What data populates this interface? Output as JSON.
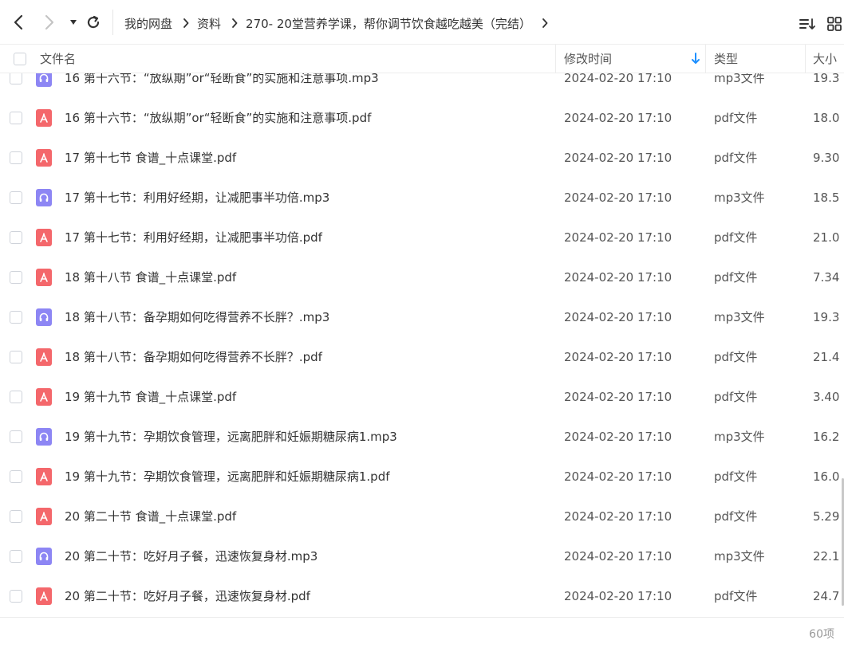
{
  "breadcrumb": {
    "items": [
      {
        "label": "我的网盘"
      },
      {
        "label": "资料"
      },
      {
        "label": "270- 20堂营养学课，帮你调节饮食越吃越美（完结）"
      }
    ]
  },
  "toolbar": {
    "back_icon": "chevron-left-icon",
    "forward_icon": "chevron-right-icon",
    "dropdown_icon": "caret-down-icon",
    "refresh_icon": "refresh-icon",
    "sort_icon": "sort-list-icon",
    "view_icon": "grid-view-icon"
  },
  "table": {
    "columns": {
      "name": "文件名",
      "modified": "修改时间",
      "type": "类型",
      "size": "大小"
    },
    "sort_indicator": "arrow-down-icon",
    "rows": [
      {
        "kind": "mp3",
        "name": "16 第十六节：“放纵期”or“轻断食”的实施和注意事项.mp3",
        "modified": "2024-02-20 17:10",
        "type": "mp3文件",
        "size": "19.3"
      },
      {
        "kind": "pdf",
        "name": "16 第十六节：“放纵期”or“轻断食”的实施和注意事项.pdf",
        "modified": "2024-02-20 17:10",
        "type": "pdf文件",
        "size": "18.0"
      },
      {
        "kind": "pdf",
        "name": "17 第十七节 食谱_十点课堂.pdf",
        "modified": "2024-02-20 17:10",
        "type": "pdf文件",
        "size": "9.30"
      },
      {
        "kind": "mp3",
        "name": "17 第十七节：利用好经期，让减肥事半功倍.mp3",
        "modified": "2024-02-20 17:10",
        "type": "mp3文件",
        "size": "18.5"
      },
      {
        "kind": "pdf",
        "name": "17 第十七节：利用好经期，让减肥事半功倍.pdf",
        "modified": "2024-02-20 17:10",
        "type": "pdf文件",
        "size": "21.0"
      },
      {
        "kind": "pdf",
        "name": "18 第十八节 食谱_十点课堂.pdf",
        "modified": "2024-02-20 17:10",
        "type": "pdf文件",
        "size": "7.34"
      },
      {
        "kind": "mp3",
        "name": "18 第十八节：备孕期如何吃得营养不长胖？.mp3",
        "modified": "2024-02-20 17:10",
        "type": "mp3文件",
        "size": "19.3"
      },
      {
        "kind": "pdf",
        "name": "18 第十八节：备孕期如何吃得营养不长胖？.pdf",
        "modified": "2024-02-20 17:10",
        "type": "pdf文件",
        "size": "21.4"
      },
      {
        "kind": "pdf",
        "name": "19 第十九节 食谱_十点课堂.pdf",
        "modified": "2024-02-20 17:10",
        "type": "pdf文件",
        "size": "3.40"
      },
      {
        "kind": "mp3",
        "name": "19 第十九节：孕期饮食管理，远离肥胖和妊娠期糖尿病1.mp3",
        "modified": "2024-02-20 17:10",
        "type": "mp3文件",
        "size": "16.2"
      },
      {
        "kind": "pdf",
        "name": "19 第十九节：孕期饮食管理，远离肥胖和妊娠期糖尿病1.pdf",
        "modified": "2024-02-20 17:10",
        "type": "pdf文件",
        "size": "16.0"
      },
      {
        "kind": "pdf",
        "name": "20 第二十节 食谱_十点课堂.pdf",
        "modified": "2024-02-20 17:10",
        "type": "pdf文件",
        "size": "5.29"
      },
      {
        "kind": "mp3",
        "name": "20 第二十节：吃好月子餐，迅速恢复身材.mp3",
        "modified": "2024-02-20 17:10",
        "type": "mp3文件",
        "size": "22.1"
      },
      {
        "kind": "pdf",
        "name": "20 第二十节：吃好月子餐，迅速恢复身材.pdf",
        "modified": "2024-02-20 17:10",
        "type": "pdf文件",
        "size": "24.7"
      }
    ]
  },
  "footer": {
    "count": "60项"
  },
  "colors": {
    "pdf_icon": "#f4676b",
    "mp3_icon": "#8d86f4",
    "sort_accent": "#1e90ff"
  }
}
